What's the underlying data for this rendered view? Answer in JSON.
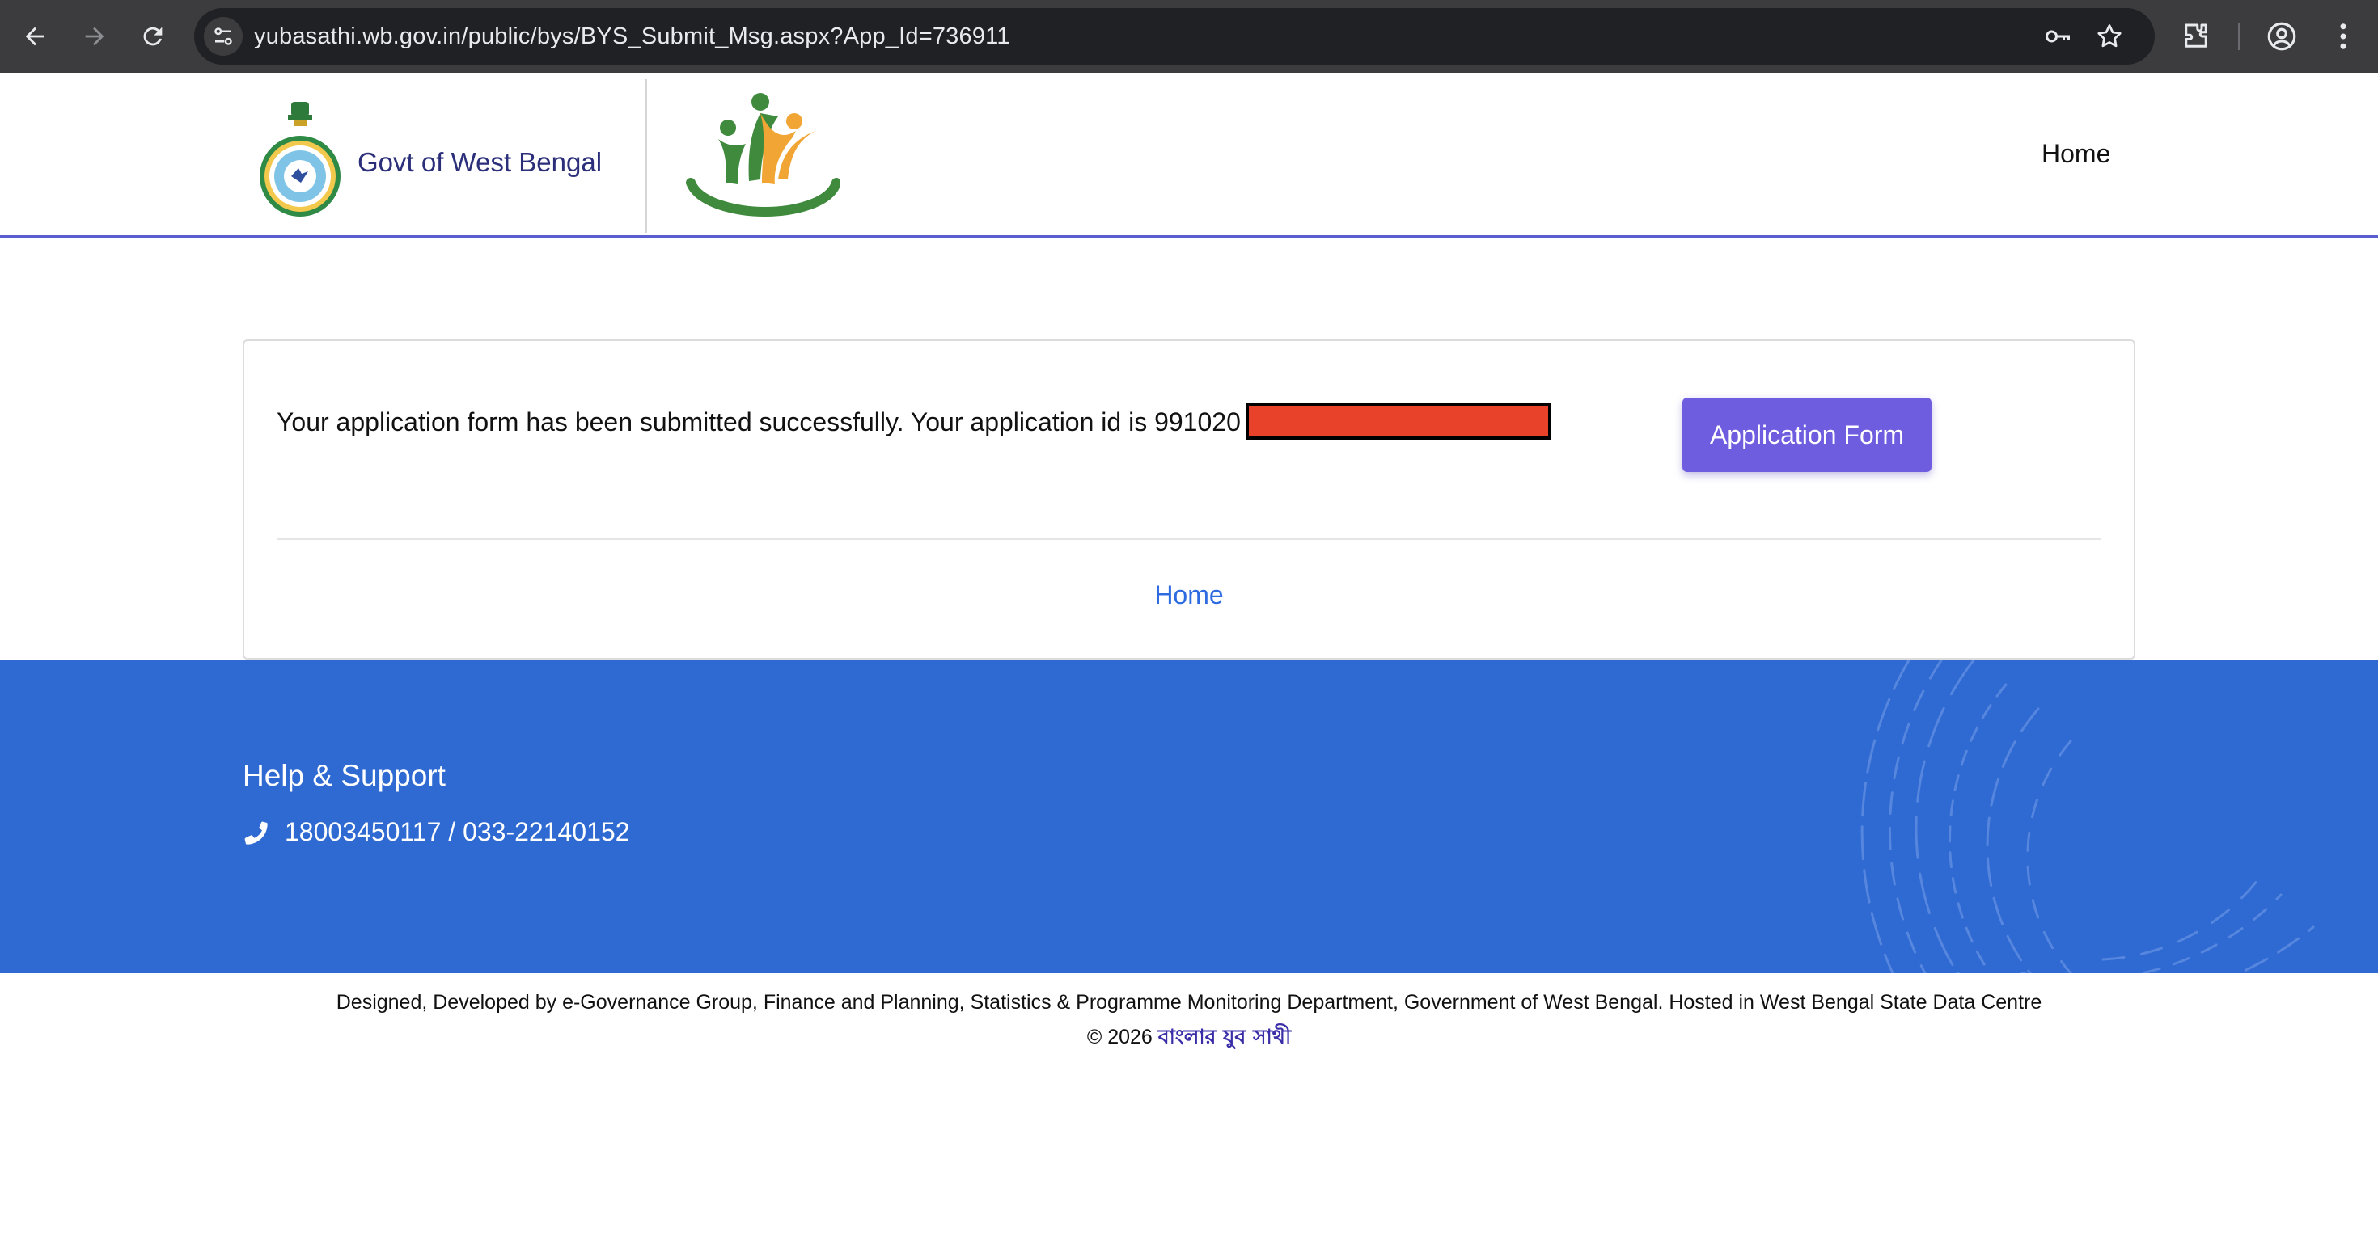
{
  "browser": {
    "url": "yubasathi.wb.gov.in/public/bys/BYS_Submit_Msg.aspx?App_Id=736911",
    "icons": [
      "back-arrow-icon",
      "forward-arrow-icon",
      "reload-icon",
      "site-info-icon",
      "password-key-icon",
      "bookmark-star-icon",
      "extensions-icon",
      "profile-icon",
      "menu-dots-icon"
    ]
  },
  "header": {
    "govt_label": "Govt of West Bengal",
    "nav_home": "Home"
  },
  "card": {
    "message": "Your application form has been submitted successfully. Your application id is 991020",
    "button_label": "Application Form",
    "home_link": "Home"
  },
  "footer": {
    "help_title": "Help & Support",
    "phone": "18003450117 / 033-22140152"
  },
  "credits": {
    "designed_by": "Designed, Developed by e-Governance Group, Finance and Planning, Statistics & Programme Monitoring Department, Government of West Bengal. Hosted in West Bengal State Data Centre",
    "copyright": "© 2026",
    "brand": "বাংলার যুব সাথী"
  },
  "colors": {
    "header_border": "#5a5fd0",
    "button": "#6f5de0",
    "link": "#2e6be0",
    "footer_band": "#2f6ad3",
    "redaction": "#e8432a"
  }
}
